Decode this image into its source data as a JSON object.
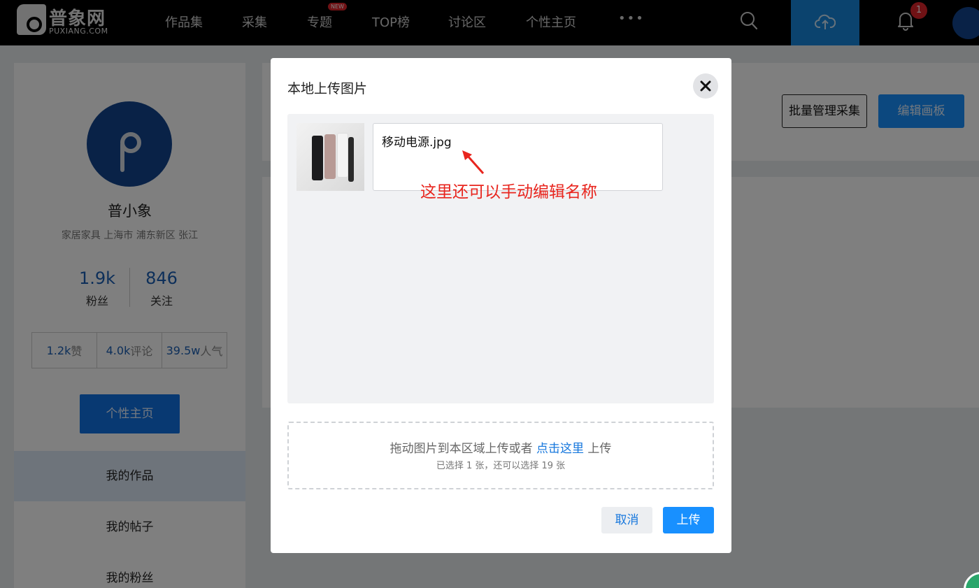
{
  "nav": {
    "logo_cn": "普象网",
    "logo_en": "PUXIANG.COM",
    "items": [
      "作品集",
      "采集",
      "专题",
      "TOP榜",
      "讨论区",
      "个性主页"
    ],
    "new_badge": "NEW",
    "more": "•••",
    "notification_count": "1",
    "icons": [
      "search-icon",
      "upload-cloud-icon",
      "bell-icon",
      "avatar"
    ]
  },
  "profile": {
    "name": "普小象",
    "meta": "家居家具   上海市 浦东新区 张江",
    "followers_count": "1.9k",
    "followers_label": "粉丝",
    "following_count": "846",
    "following_label": "关注",
    "likes_num": "1.2k",
    "likes_unit": "赞",
    "comments_num": "4.0k",
    "comments_unit": "评论",
    "popularity_num": "39.5w",
    "popularity_unit": "人气",
    "home_button": "个性主页",
    "menu": [
      "我的作品",
      "我的帖子",
      "我的粉丝"
    ]
  },
  "board": {
    "batch_button": "批量管理采集",
    "edit_button": "编辑画板"
  },
  "modal": {
    "title": "本地上传图片",
    "file_name": "移动电源.jpg",
    "annotation": "这里还可以手动编辑名称",
    "drop_text": "拖动图片到本区域上传或者",
    "drop_link": "点击这里",
    "drop_suffix": "上传",
    "selection_info": "已选择 1 张，还可以选择 19 张",
    "cancel": "取消",
    "upload": "上传"
  },
  "colors": {
    "accent": "#1890ff",
    "annotation": "#e8251e",
    "nav_bg": "#000000",
    "brand_dark_blue": "#12458f"
  }
}
